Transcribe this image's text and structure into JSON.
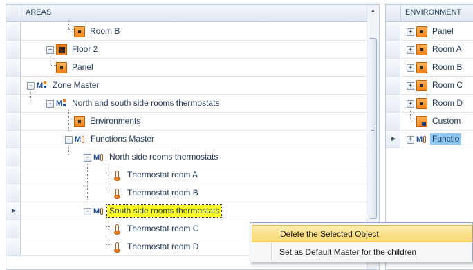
{
  "left_panel": {
    "header": "AREAS",
    "rows": [
      {
        "label": "Room B",
        "icon": "room-icon",
        "expander": "",
        "selected": ""
      },
      {
        "label": "Floor 2",
        "icon": "floor-icon",
        "expander": "+",
        "selected": ""
      },
      {
        "label": "Panel",
        "icon": "room-icon",
        "expander": "",
        "selected": ""
      },
      {
        "label": "Zone Master",
        "icon": "zone-master-icon",
        "expander": "-",
        "selected": ""
      },
      {
        "label": "North and south side rooms thermostats",
        "icon": "zone-master-icon",
        "expander": "-",
        "selected": ""
      },
      {
        "label": "Environments",
        "icon": "room-icon",
        "expander": "",
        "selected": ""
      },
      {
        "label": "Functions Master",
        "icon": "functions-master-icon",
        "expander": "-",
        "selected": ""
      },
      {
        "label": "North side rooms thermostats",
        "icon": "functions-master-icon",
        "expander": "-",
        "selected": ""
      },
      {
        "label": "Thermostat room A",
        "icon": "thermometer-icon",
        "expander": "",
        "selected": ""
      },
      {
        "label": "Thermostat room B",
        "icon": "thermometer-icon",
        "expander": "",
        "selected": ""
      },
      {
        "label": "South side rooms thermostats",
        "icon": "functions-master-icon",
        "expander": "-",
        "selected": "yellow"
      },
      {
        "label": "Thermostat room C",
        "icon": "thermometer-icon",
        "expander": "",
        "selected": ""
      },
      {
        "label": "Thermostat room D",
        "icon": "thermometer-icon",
        "expander": "",
        "selected": ""
      }
    ]
  },
  "right_panel": {
    "header": "ENVIRONMENT",
    "rows": [
      {
        "label": "Panel",
        "icon": "room-icon",
        "expander": "+"
      },
      {
        "label": "Room A",
        "icon": "room-icon",
        "expander": "+"
      },
      {
        "label": "Room B",
        "icon": "room-icon",
        "expander": "+"
      },
      {
        "label": "Room C",
        "icon": "room-icon",
        "expander": "+"
      },
      {
        "label": "Room D",
        "icon": "room-icon",
        "expander": "+"
      },
      {
        "label": "Custom",
        "icon": "custom-room-icon",
        "expander": ""
      },
      {
        "label": "Functio",
        "icon": "functions-master-icon",
        "expander": "+"
      }
    ]
  },
  "context_menu": {
    "items": [
      {
        "label": "Delete the Selected Object",
        "highlighted": true
      },
      {
        "label": "Set as Default Master for the children",
        "highlighted": false
      }
    ]
  },
  "colors": {
    "selection_yellow": "#ffff24",
    "selection_blue": "#8fc8f3",
    "menu_highlight": "#fbd66b",
    "icon_orange": "#f2821a",
    "text": "#1e395b"
  }
}
